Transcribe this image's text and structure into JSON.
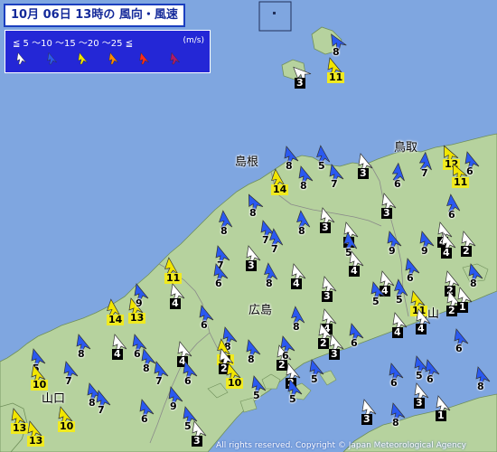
{
  "title": "10月 06日 13時の 風向・風速",
  "legend": {
    "scale": "≦ 5 〜10 〜15 〜20 〜25 ≦",
    "unit": "(m/s)",
    "colors": [
      "#ffffff",
      "#2a59f0",
      "#f2e600",
      "#ff8a00",
      "#ff2a1a",
      "#b0186a"
    ]
  },
  "places": {
    "shimane": "島根",
    "tottori": "鳥取",
    "hiroshima": "広島",
    "okayama": "岡山",
    "yamaguchi": "山口"
  },
  "copyright": "All rights reserved. Copyright © Japan Meteorological Agency",
  "stations": [
    {
      "id": "okinoshima-n",
      "speed": "8",
      "color": "blue",
      "dir": 135
    },
    {
      "id": "okinoshima-w",
      "speed": "3",
      "color": "white",
      "dir": 120
    },
    {
      "id": "okinoshima-e",
      "speed": "11",
      "color": "yellow",
      "dir": 150
    },
    {
      "id": "matsue-w",
      "speed": "8",
      "color": "blue",
      "dir": 150
    },
    {
      "id": "matsue",
      "speed": "5",
      "color": "blue",
      "dir": 160
    },
    {
      "id": "yasugi",
      "speed": "3",
      "color": "white",
      "dir": 150
    },
    {
      "id": "izumo",
      "speed": "14",
      "color": "yellow",
      "dir": 160
    },
    {
      "id": "hirata",
      "speed": "8",
      "color": "blue",
      "dir": 150
    },
    {
      "id": "kisuki",
      "speed": "7",
      "color": "blue",
      "dir": 150
    },
    {
      "id": "yonago",
      "speed": "6",
      "color": "blue",
      "dir": 170
    },
    {
      "id": "kurayoshi",
      "speed": "7",
      "color": "blue",
      "dir": 170
    },
    {
      "id": "tottori",
      "speed": "12",
      "color": "yellow",
      "dir": 140
    },
    {
      "id": "tottori-e",
      "speed": "11",
      "color": "yellow",
      "dir": 140
    },
    {
      "id": "iwami",
      "speed": "6",
      "color": "blue",
      "dir": 150
    },
    {
      "id": "ohda",
      "speed": "8",
      "color": "blue",
      "dir": 140
    },
    {
      "id": "akana",
      "speed": "8",
      "color": "blue",
      "dir": 160
    },
    {
      "id": "yokota",
      "speed": "3",
      "color": "white",
      "dir": 150
    },
    {
      "id": "chizu",
      "speed": "6",
      "color": "blue",
      "dir": 160
    },
    {
      "id": "hino",
      "speed": "3",
      "color": "white",
      "dir": 150
    },
    {
      "id": "kawamoto",
      "speed": "7",
      "color": "blue",
      "dir": 150
    },
    {
      "id": "iinan",
      "speed": "8",
      "color": "blue",
      "dir": 160
    },
    {
      "id": "misaka",
      "speed": "7",
      "color": "blue",
      "dir": 160
    },
    {
      "id": "tojo",
      "speed": "4",
      "color": "white",
      "dir": 150
    },
    {
      "id": "niimi",
      "speed": "4",
      "color": "white",
      "dir": 150
    },
    {
      "id": "chizu-s",
      "speed": "5",
      "color": "blue",
      "dir": 160
    },
    {
      "id": "tsuyama",
      "speed": "9",
      "color": "blue",
      "dir": 150
    },
    {
      "id": "mimasaka",
      "speed": "9",
      "color": "blue",
      "dir": 150
    },
    {
      "id": "nishiawakura",
      "speed": "4",
      "color": "white",
      "dir": 150
    },
    {
      "id": "sayo",
      "speed": "2",
      "color": "white",
      "dir": 150
    },
    {
      "id": "ohasa",
      "speed": "3",
      "color": "white",
      "dir": 150
    },
    {
      "id": "hamada",
      "speed": "7",
      "color": "blue",
      "dir": 150
    },
    {
      "id": "masuda",
      "speed": "11",
      "color": "yellow",
      "dir": 160
    },
    {
      "id": "yoshika",
      "speed": "4",
      "color": "white",
      "dir": 150
    },
    {
      "id": "miyoshi",
      "speed": "6",
      "color": "blue",
      "dir": 150
    },
    {
      "id": "shobara",
      "speed": "8",
      "color": "blue",
      "dir": 160
    },
    {
      "id": "saijo",
      "speed": "4",
      "color": "white",
      "dir": 150
    },
    {
      "id": "takahashi",
      "speed": "4",
      "color": "white",
      "dir": 150
    },
    {
      "id": "ibara",
      "speed": "2",
      "color": "white",
      "dir": 150
    },
    {
      "id": "kasaoka",
      "speed": "5",
      "color": "blue",
      "dir": 150
    },
    {
      "id": "katsuyama",
      "speed": "5",
      "color": "blue",
      "dir": 160
    },
    {
      "id": "kurashiki",
      "speed": "8",
      "color": "blue",
      "dir": 150
    },
    {
      "id": "okayama",
      "speed": "11",
      "color": "yellow",
      "dir": 150
    },
    {
      "id": "nagi",
      "speed": "6",
      "color": "blue",
      "dir": 150
    },
    {
      "id": "wake",
      "speed": "3",
      "color": "white",
      "dir": 150
    },
    {
      "id": "hinase",
      "speed": "2",
      "color": "white",
      "dir": 150
    },
    {
      "id": "akaiwa",
      "speed": "1",
      "color": "white",
      "dir": 150
    },
    {
      "id": "hagi-w",
      "speed": "14",
      "color": "yellow",
      "dir": 160
    },
    {
      "id": "hagi",
      "speed": "13",
      "color": "yellow",
      "dir": 150
    },
    {
      "id": "susa",
      "speed": "9",
      "color": "blue",
      "dir": 150
    },
    {
      "id": "tokuji",
      "speed": "4",
      "color": "white",
      "dir": 150
    },
    {
      "id": "akiota",
      "speed": "6",
      "color": "blue",
      "dir": 150
    },
    {
      "id": "hiroshima",
      "speed": "8",
      "color": "blue",
      "dir": 160
    },
    {
      "id": "higashihiroshima",
      "speed": "4",
      "color": "white",
      "dir": 150
    },
    {
      "id": "takehara",
      "speed": "2",
      "color": "white",
      "dir": 150
    },
    {
      "id": "onomichi",
      "speed": "6",
      "color": "blue",
      "dir": 150
    },
    {
      "id": "fukuyama",
      "speed": "4",
      "color": "white",
      "dir": 150
    },
    {
      "id": "shimonoseki-n",
      "speed": "8",
      "color": "blue",
      "dir": 150
    },
    {
      "id": "mine",
      "speed": "4",
      "color": "white",
      "dir": 150
    },
    {
      "id": "yamaguchi-n",
      "speed": "8",
      "color": "blue",
      "dir": 150
    },
    {
      "id": "kano",
      "speed": "6",
      "color": "blue",
      "dir": 150
    },
    {
      "id": "iwakuni-n",
      "speed": "2",
      "color": "white",
      "dir": 150
    },
    {
      "id": "otake",
      "speed": "11",
      "color": "yellow",
      "dir": 160
    },
    {
      "id": "kure-n",
      "speed": "8",
      "color": "blue",
      "dir": 150
    },
    {
      "id": "kure",
      "speed": "6",
      "color": "blue",
      "dir": 150
    },
    {
      "id": "kure-s",
      "speed": "3",
      "color": "white",
      "dir": 150
    },
    {
      "id": "mihara",
      "speed": "4",
      "color": "white",
      "dir": 150
    },
    {
      "id": "innoshima",
      "speed": "6",
      "color": "blue",
      "dir": 150
    },
    {
      "id": "tamano",
      "speed": "5",
      "color": "blue",
      "dir": 150
    },
    {
      "id": "ushimado",
      "speed": "4",
      "color": "white",
      "dir": 150
    },
    {
      "id": "shimonoseki",
      "speed": "8",
      "color": "blue",
      "dir": 150
    },
    {
      "id": "toyota",
      "speed": "7",
      "color": "blue",
      "dir": 150
    },
    {
      "id": "ube",
      "speed": "10",
      "color": "yellow",
      "dir": 150
    },
    {
      "id": "yamaguchi",
      "speed": "7",
      "color": "blue",
      "dir": 150
    },
    {
      "id": "hofu",
      "speed": "8",
      "color": "blue",
      "dir": 150
    },
    {
      "id": "tokuyama",
      "speed": "6",
      "color": "blue",
      "dir": 150
    },
    {
      "id": "kudamatsu",
      "speed": "2",
      "color": "white",
      "dir": 150
    },
    {
      "id": "yanai",
      "speed": "10",
      "color": "yellow",
      "dir": 150
    },
    {
      "id": "oshima",
      "speed": "5",
      "color": "blue",
      "dir": 150
    },
    {
      "id": "kamikamagari",
      "speed": "2",
      "color": "white",
      "dir": 150
    },
    {
      "id": "omishima",
      "speed": "5",
      "color": "blue",
      "dir": 150
    },
    {
      "id": "takamatsu-w",
      "speed": "6",
      "color": "blue",
      "dir": 150
    },
    {
      "id": "shodoshima",
      "speed": "5",
      "color": "blue",
      "dir": 150
    },
    {
      "id": "shimonoseki-s",
      "speed": "13",
      "color": "yellow",
      "dir": 150
    },
    {
      "id": "moji",
      "speed": "13",
      "color": "yellow",
      "dir": 150
    },
    {
      "id": "ube-s",
      "speed": "10",
      "color": "yellow",
      "dir": 150
    },
    {
      "id": "hikari",
      "speed": "7",
      "color": "blue",
      "dir": 150
    },
    {
      "id": "kaminoseki",
      "speed": "6",
      "color": "blue",
      "dir": 150
    },
    {
      "id": "muroto-w",
      "speed": "9",
      "color": "blue",
      "dir": 150
    },
    {
      "id": "imabari",
      "speed": "5",
      "color": "blue",
      "dir": 150
    },
    {
      "id": "kurushima",
      "speed": "3",
      "color": "white",
      "dir": 150
    },
    {
      "id": "niihama",
      "speed": "5",
      "color": "blue",
      "dir": 150
    },
    {
      "id": "tadotsu",
      "speed": "3",
      "color": "white",
      "dir": 150
    },
    {
      "id": "kanonji",
      "speed": "6",
      "color": "blue",
      "dir": 150
    },
    {
      "id": "marugame",
      "speed": "3",
      "color": "white",
      "dir": 150
    },
    {
      "id": "sakaide",
      "speed": "1",
      "color": "white",
      "dir": 150
    },
    {
      "id": "takamatsu",
      "speed": "8",
      "color": "blue",
      "dir": 150
    },
    {
      "id": "yaimashima",
      "speed": "8",
      "color": "blue",
      "dir": 150
    }
  ]
}
